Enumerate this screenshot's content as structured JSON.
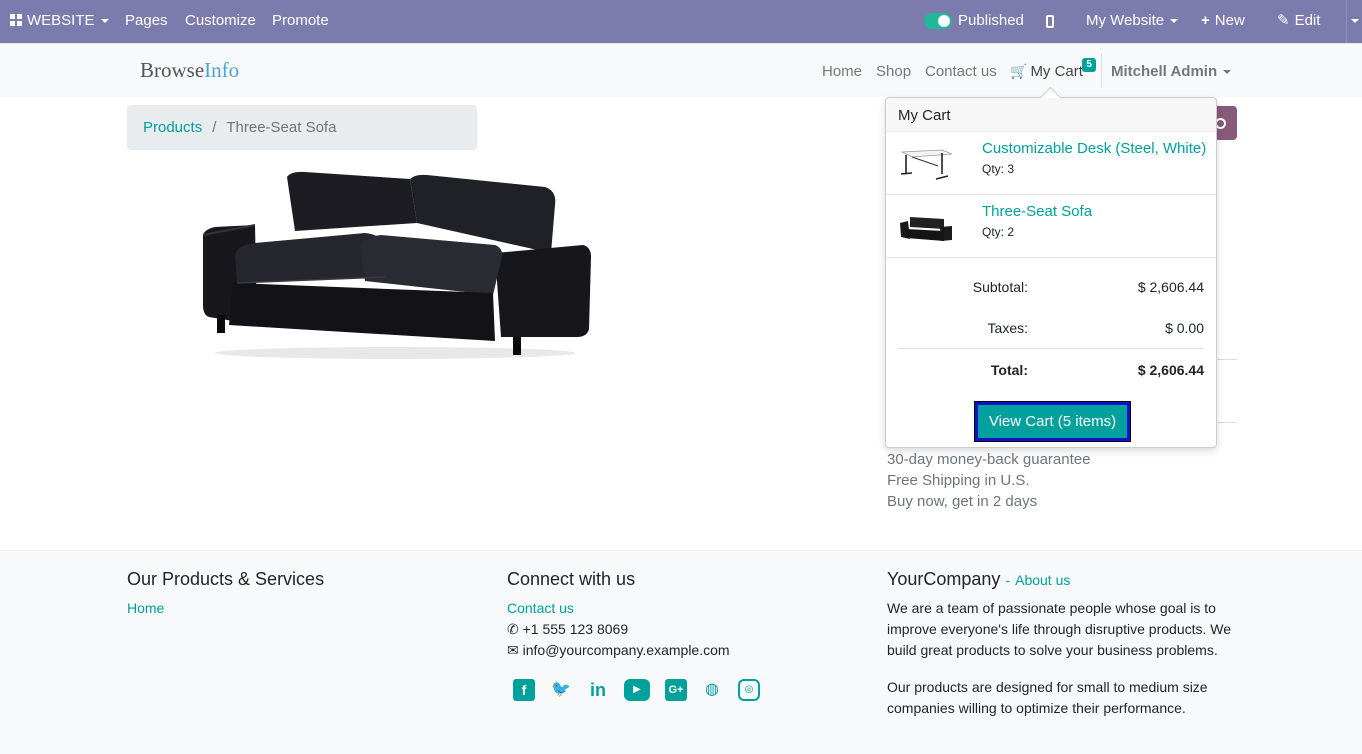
{
  "adminbar": {
    "website": "WEBSITE",
    "pages": "Pages",
    "customize": "Customize",
    "promote": "Promote",
    "published": "Published",
    "my_website": "My Website",
    "new": "New",
    "edit": "Edit"
  },
  "header": {
    "brand_a": "Browse",
    "brand_b": "Info",
    "nav": [
      "Home",
      "Shop",
      "Contact us"
    ],
    "cart_label": "My Cart",
    "cart_count": "5",
    "user": "Mitchell Admin"
  },
  "breadcrumb": {
    "parent": "Products",
    "separator": "/",
    "current": "Three-Seat Sofa"
  },
  "cart_popover": {
    "title": "My Cart",
    "lines": [
      {
        "name": "Customizable Desk (Steel, White)",
        "qty": "Qty: 3"
      },
      {
        "name": "Three-Seat Sofa",
        "qty": "Qty: 2"
      }
    ],
    "subtotal_label": "Subtotal:",
    "subtotal": "$ 2,606.44",
    "taxes_label": "Taxes:",
    "taxes": "$ 0.00",
    "total_label": "Total:",
    "total": "$ 2,606.44",
    "view_cart": "View Cart (5 items)"
  },
  "guarantees": [
    "30-day money-back guarantee",
    "Free Shipping in U.S.",
    "Buy now, get in 2 days"
  ],
  "footer": {
    "col1_title": "Our Products & Services",
    "col1_link": "Home",
    "col2_title": "Connect with us",
    "col2_link": "Contact us",
    "phone": "+1 555 123 8069",
    "email": "info@yourcompany.example.com",
    "social_icons": [
      "facebook-icon",
      "twitter-icon",
      "linkedin-icon",
      "youtube-icon",
      "google-plus-icon",
      "github-icon",
      "instagram-icon"
    ],
    "col3_title": "YourCompany",
    "col3_dash": "-",
    "about_link": "About us",
    "about_p1": "We are a team of passionate people whose goal is to improve everyone's life through disruptive products. We build great products to solve your business problems.",
    "about_p2": "Our products are designed for small to medium size companies willing to optimize their performance."
  },
  "colors": {
    "adminbar": "#7c7bad",
    "accent": "#00a09d",
    "search_button": "#875a7b"
  }
}
